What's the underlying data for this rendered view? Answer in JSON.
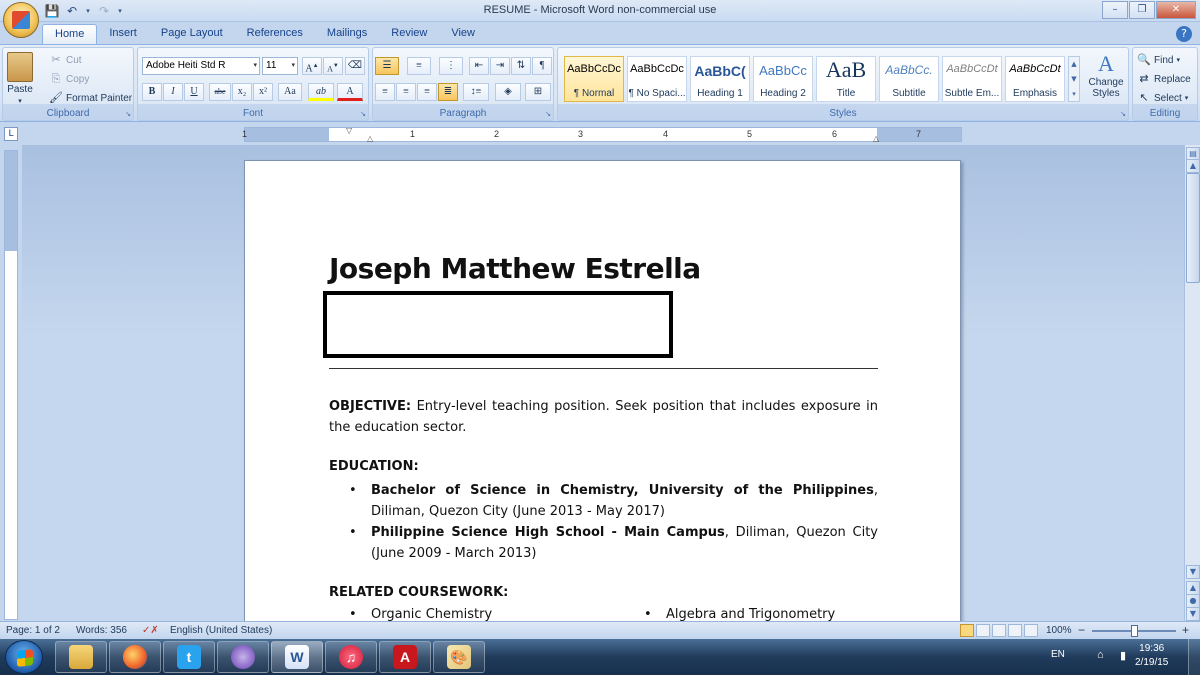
{
  "window": {
    "title": "RESUME - Microsoft Word non-commercial use",
    "controls": [
      "–",
      "❐",
      "✕"
    ]
  },
  "tabs": [
    "Home",
    "Insert",
    "Page Layout",
    "References",
    "Mailings",
    "Review",
    "View"
  ],
  "ribbon": {
    "clipboard": {
      "label": "Clipboard",
      "paste": "Paste",
      "cut": "Cut",
      "copy": "Copy",
      "format_painter": "Format Painter"
    },
    "font": {
      "label": "Font",
      "font_name": "Adobe Heiti Std R",
      "font_size": "11",
      "grow": "A",
      "shrink": "A",
      "bold": "B",
      "italic": "I",
      "underline": "U",
      "strike": "abe",
      "subscript": "x₂",
      "superscript": "x²",
      "change_case": "Aa",
      "highlight": "ab",
      "font_color": "A"
    },
    "paragraph": {
      "label": "Paragraph"
    },
    "styles": {
      "label": "Styles",
      "items": [
        {
          "sample": "AaBbCcDc",
          "name": "¶ Normal"
        },
        {
          "sample": "AaBbCcDc",
          "name": "¶ No Spaci..."
        },
        {
          "sample": "AaBbC(",
          "name": "Heading 1"
        },
        {
          "sample": "AaBbCc",
          "name": "Heading 2"
        },
        {
          "sample": "AaB",
          "name": "Title"
        },
        {
          "sample": "AaBbCc.",
          "name": "Subtitle"
        },
        {
          "sample": "AaBbCcDt",
          "name": "Subtle Em..."
        },
        {
          "sample": "AaBbCcDt",
          "name": "Emphasis"
        }
      ],
      "change_styles": "Change Styles"
    },
    "editing": {
      "label": "Editing",
      "find": "Find",
      "replace": "Replace",
      "select": "Select"
    }
  },
  "ruler": {
    "numbers": [
      "1",
      "1",
      "2",
      "3",
      "4",
      "5",
      "6",
      "7"
    ]
  },
  "document": {
    "name": "Joseph Matthew Estrella",
    "objective_label": "OBJECTIVE:",
    "objective_text": " Entry-level teaching position. Seek position that includes exposure in the education sector.",
    "education_heading": "EDUCATION:",
    "education": [
      {
        "bold": "Bachelor of Science in Chemistry, University of the Philippines",
        "rest": ", Diliman, Quezon City (June 2013 - May 2017)"
      },
      {
        "bold": "Philippine Science High School - Main Campus",
        "rest": ", Diliman, Quezon City (June 2009 - March 2013)"
      }
    ],
    "coursework_heading": "RELATED COURSEWORK:",
    "coursework": [
      "Organic Chemistry",
      "Algebra and Trigonometry"
    ]
  },
  "statusbar": {
    "page": "Page: 1 of 2",
    "words": "Words: 356",
    "language": "English (United States)",
    "zoom": "100%",
    "zoom_minus": "−",
    "zoom_plus": "+"
  },
  "taskbar": {
    "apps": [
      "Windows Explorer",
      "Firefox",
      "Twitter",
      "BitTorrent",
      "Microsoft Word",
      "iTunes",
      "Adobe Reader",
      "Paint"
    ],
    "lang": "EN",
    "time": "19:36",
    "date": "2/19/15"
  }
}
